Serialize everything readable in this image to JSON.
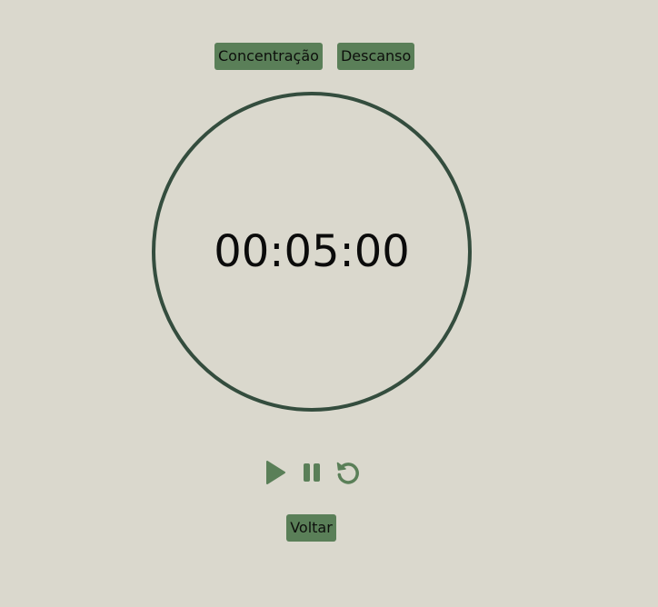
{
  "modes": {
    "focus_label": "Concentração",
    "rest_label": "Descanso"
  },
  "timer": {
    "display": "00:05:00"
  },
  "controls": {
    "play_icon": "play-icon",
    "pause_icon": "pause-icon",
    "reset_icon": "reset-icon"
  },
  "footer": {
    "back_label": "Voltar"
  },
  "colors": {
    "background": "#dad8cd",
    "accent": "#5a7f58",
    "ring": "#344d3e",
    "icon": "#5a7f58"
  }
}
